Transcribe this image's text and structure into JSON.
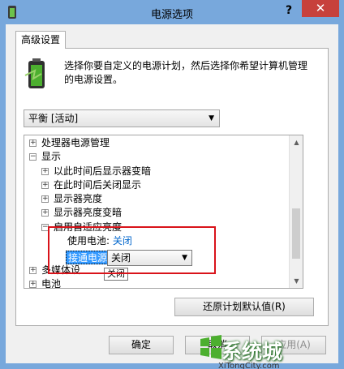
{
  "window": {
    "title": "电源选项",
    "help": "?",
    "close": "✕"
  },
  "tab": {
    "label": "高级设置"
  },
  "description": "选择你要自定义的电源计划，然后选择你希望计算机管理的电源设置。",
  "plan_select": {
    "value": "平衡 [活动]"
  },
  "tree": {
    "items": [
      {
        "expander": "+",
        "label": "处理器电源管理"
      },
      {
        "expander": "−",
        "label": "显示"
      },
      {
        "expander": "+",
        "label": "以此时间后显示器变暗"
      },
      {
        "expander": "+",
        "label": "在此时间后关闭显示"
      },
      {
        "expander": "+",
        "label": "显示器亮度"
      },
      {
        "expander": "+",
        "label": "显示器亮度变暗"
      },
      {
        "expander": "−",
        "label": "启用自适应亮度"
      },
      {
        "expander": "+",
        "label": "多媒体设"
      },
      {
        "expander": "+",
        "label": "电池"
      }
    ],
    "battery_setting": {
      "label": "使用电池:",
      "value": "关闭"
    },
    "ac_setting": {
      "label": "接通电源:",
      "value": "关闭",
      "tooltip": "关闭"
    }
  },
  "buttons": {
    "restore": "还原计划默认值(R)",
    "ok": "确定",
    "cancel": "取消",
    "apply": "应用(A)"
  },
  "watermark": {
    "text": "系统城",
    "sub": "XiTongCity.com"
  },
  "colors": {
    "accent_red": "#d9131a",
    "selection": "#3399ff",
    "close_red": "#c7413c",
    "title_blue": "#78a8dc"
  }
}
